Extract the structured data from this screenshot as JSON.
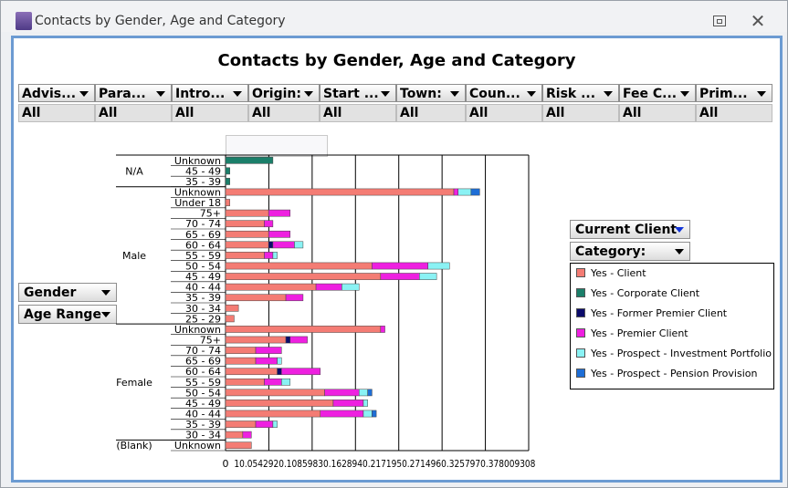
{
  "window": {
    "title": "Contacts by Gender, Age and Category"
  },
  "filters": [
    {
      "label": "Advis...",
      "value": "All"
    },
    {
      "label": "Para...",
      "value": "All"
    },
    {
      "label": "Intro...",
      "value": "All"
    },
    {
      "label": "Origin:",
      "value": "All"
    },
    {
      "label": "Start ...",
      "value": "All"
    },
    {
      "label": "Town:",
      "value": "All"
    },
    {
      "label": "Coun...",
      "value": "All"
    },
    {
      "label": "Risk ...",
      "value": "All"
    },
    {
      "label": "Fee C...",
      "value": "All"
    },
    {
      "label": "Prim...",
      "value": "All"
    }
  ],
  "row_fields": {
    "gender": "Gender",
    "age_range": "Age Range"
  },
  "series_field": {
    "category_label": "Category:",
    "selected": "Current Client"
  },
  "chart_data": {
    "type": "bar",
    "orientation": "horizontal",
    "stacked": true,
    "title": "Contacts by Gender, Age and Category",
    "xlim": [
      0,
      70.378009308
    ],
    "xticks": [
      "0",
      "10.054",
      "20.108",
      "30.162",
      "40.217",
      "50.271",
      "60.325",
      "70.378009308"
    ],
    "xtick_label_raw": "0 10.0542920.10859830.1628940.2171950.2714960.3257970.378009308",
    "groups": [
      {
        "name": "N/A",
        "categories": [
          "Unknown",
          "45 - 49",
          "35 - 39"
        ]
      },
      {
        "name": "Male",
        "categories": [
          "Unknown",
          "Under 18",
          "75+",
          "70 - 74",
          "65 - 69",
          "60 - 64",
          "55 - 59",
          "50 - 54",
          "45 - 49",
          "40 - 44",
          "35 - 39",
          "30 - 34",
          "25 - 29"
        ]
      },
      {
        "name": "Female",
        "categories": [
          "Unknown",
          "75+",
          "70 - 74",
          "65 - 69",
          "60 - 64",
          "55 - 59",
          "50 - 54",
          "45 - 49",
          "40 - 44",
          "35 - 39",
          "30 - 34"
        ]
      },
      {
        "name": "(Blank)",
        "categories": [
          "Unknown"
        ]
      }
    ],
    "series": [
      {
        "name": "Yes - Client",
        "color": "#f47c74",
        "values": [
          0,
          0,
          0,
          53,
          1,
          10,
          9,
          10,
          10,
          9,
          34,
          36,
          21,
          14,
          3,
          2,
          36,
          14,
          7,
          7,
          12,
          9,
          23,
          25,
          22,
          7,
          4,
          6
        ]
      },
      {
        "name": "Yes - Corporate Client",
        "color": "#1b7f6a",
        "values": [
          11,
          1,
          1,
          0,
          0,
          0,
          0,
          0,
          0,
          0,
          0,
          0,
          0,
          0,
          0,
          0,
          0,
          0,
          0,
          0,
          0,
          0,
          0,
          0,
          0,
          0,
          0,
          0
        ]
      },
      {
        "name": "Yes - Former Premier Client",
        "color": "#0b0b6b",
        "values": [
          0,
          0,
          0,
          0,
          0,
          0,
          0,
          0,
          1,
          0,
          0,
          0,
          0,
          0,
          0,
          0,
          0,
          1,
          0,
          0,
          1,
          0,
          0,
          0,
          0,
          0,
          0,
          0
        ]
      },
      {
        "name": "Yes - Premier Client",
        "color": "#ee20e0",
        "values": [
          0,
          0,
          0,
          1,
          0,
          5,
          2,
          5,
          5,
          2,
          13,
          9,
          6,
          4,
          0,
          0,
          1,
          4,
          6,
          5,
          9,
          4,
          8,
          7,
          10,
          4,
          2,
          0
        ]
      },
      {
        "name": "Yes - Prospect - Investment Portfolio",
        "color": "#8af2f4",
        "values": [
          0,
          0,
          0,
          3,
          0,
          0,
          0,
          0,
          2,
          1,
          5,
          4,
          4,
          0,
          0,
          0,
          0,
          0,
          0,
          1,
          0,
          2,
          2,
          1,
          2,
          1,
          0,
          0
        ]
      },
      {
        "name": "Yes - Prospect - Pension Provision",
        "color": "#1e6ed6",
        "values": [
          0,
          0,
          0,
          2,
          0,
          0,
          0,
          0,
          0,
          0,
          0,
          0,
          0,
          0,
          0,
          0,
          0,
          0,
          0,
          0,
          0,
          0,
          1,
          0,
          1,
          0,
          0,
          0
        ]
      }
    ]
  }
}
